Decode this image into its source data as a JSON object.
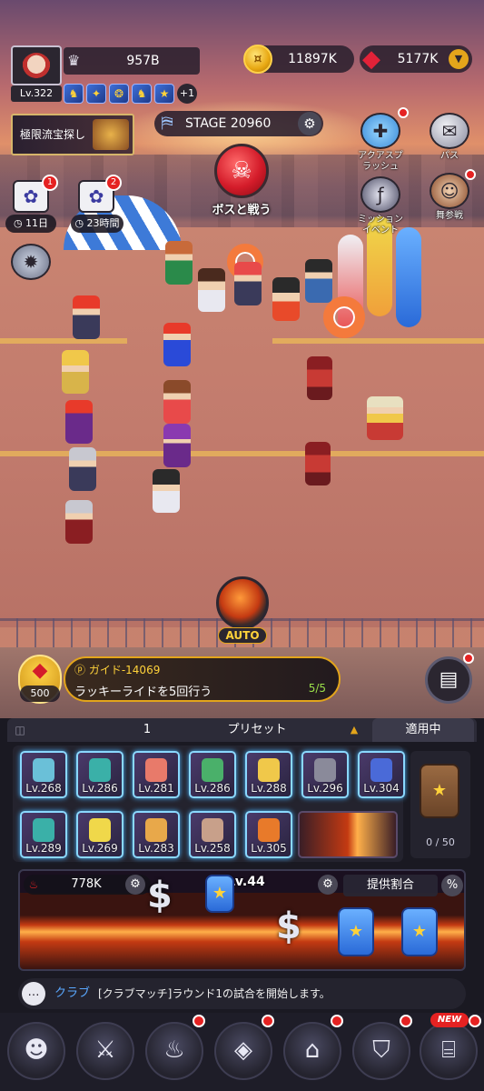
{
  "player": {
    "level": "Lv.322",
    "power": "957B",
    "buff_more": "+1"
  },
  "currency": {
    "gold": "11897K",
    "gems": "5177K"
  },
  "event": {
    "label": "極限流宝探し"
  },
  "stage": {
    "label": "STAGE 20960"
  },
  "boss": {
    "label": "ボスと戦う"
  },
  "side_buttons": {
    "rush": "アクアスプラッシュ",
    "pass": "パス",
    "mission": "ミッションイベント",
    "stage_join": "舞参戦"
  },
  "gifts": [
    {
      "badge": "1",
      "timer": "11日"
    },
    {
      "badge": "2",
      "timer": "23時間"
    }
  ],
  "auto": {
    "label": "AUTO"
  },
  "guide": {
    "reward": "500",
    "title": "ガイド-14069",
    "task": "ラッキーライドを5回行う",
    "progress": "5/5"
  },
  "preset": {
    "number": "1",
    "label": "プリセット",
    "status": "適用中"
  },
  "gear": [
    {
      "level": "Lv.268",
      "color": "#6ac0d8"
    },
    {
      "level": "Lv.286",
      "color": "#3ab0a8"
    },
    {
      "level": "Lv.281",
      "color": "#e87a6a"
    },
    {
      "level": "Lv.286",
      "color": "#4ab06a"
    },
    {
      "level": "Lv.288",
      "color": "#f0c84a"
    },
    {
      "level": "Lv.296",
      "color": "#8a8a9a"
    },
    {
      "level": "Lv.304",
      "color": "#4a6ad8"
    },
    {
      "level": "Lv.289",
      "color": "#3ab0a8"
    },
    {
      "level": "Lv.269",
      "color": "#f0d84a"
    },
    {
      "level": "Lv.283",
      "color": "#e8a84a"
    },
    {
      "level": "Lv.258",
      "color": "#c8a08a"
    },
    {
      "level": "Lv.305",
      "color": "#e87a2a"
    }
  ],
  "backpack": {
    "count": "0 / 50"
  },
  "battle": {
    "power": "778K",
    "level": "Lv.44",
    "rate_label": "提供割合",
    "percent": "%"
  },
  "chat": {
    "channel": "クラブ",
    "message": "[クラブマッチ]ラウンド1の試合を開始します。"
  },
  "nav": {
    "new_label": "NEW"
  }
}
